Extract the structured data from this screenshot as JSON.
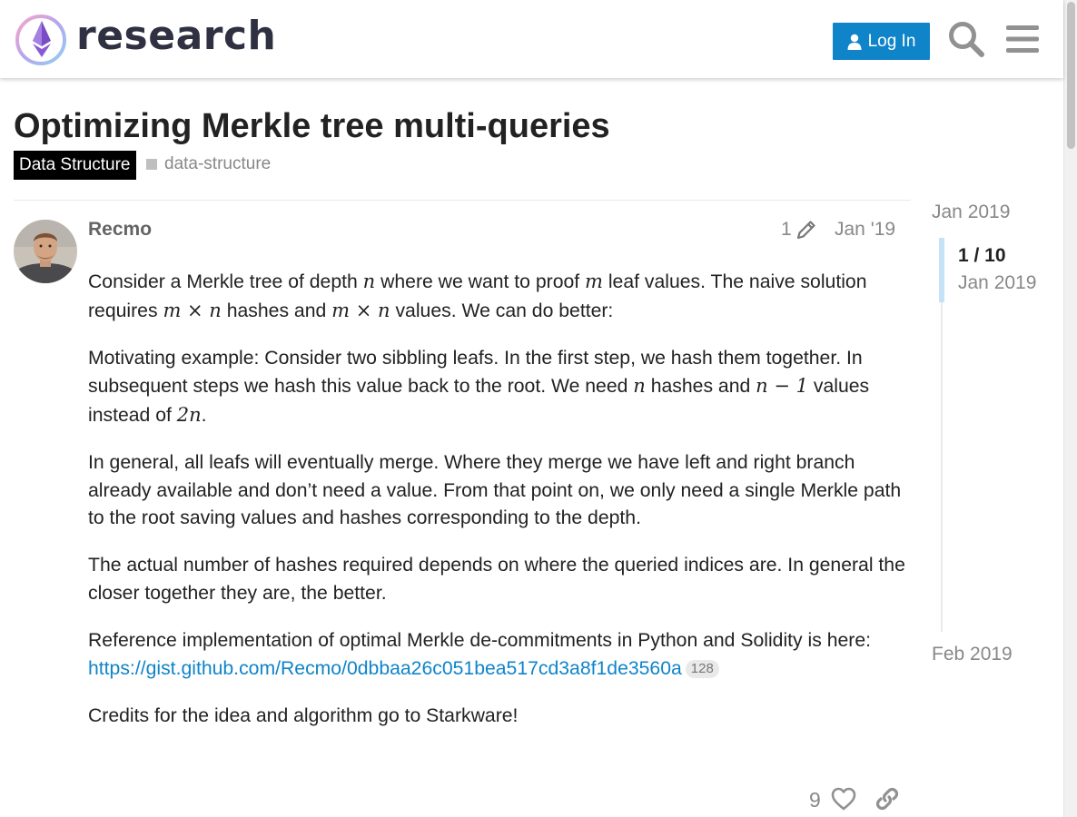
{
  "site": {
    "name": "research",
    "login_label": "Log In",
    "brand_color": "#0f84c9"
  },
  "topic": {
    "title": "Optimizing Merkle tree multi-queries",
    "category": "Data Structure",
    "tag": "data-structure"
  },
  "post": {
    "username": "Recmo",
    "edit_count": "1",
    "date": "Jan '19",
    "p1_a": "Consider a Merkle tree of depth ",
    "p1_math1": "n",
    "p1_b": " where we want to proof ",
    "p1_math2": "m",
    "p1_c": " leaf values. The naive solution requires ",
    "p1_math3": "m × n",
    "p1_d": " hashes and ",
    "p1_math4": "m × n",
    "p1_e": " values. We can do better:",
    "p2_a": "Motivating example: Consider two sibbling leafs. In the first step, we hash them together. In subsequent steps we hash this value back to the root. We need ",
    "p2_math1": "n",
    "p2_b": " hashes and ",
    "p2_math2": "n − 1",
    "p2_c": " values instead of ",
    "p2_math3": "2n",
    "p2_d": ".",
    "p3": "In general, all leafs will eventually merge. Where they merge we have left and right branch already available and don’t need a value. From that point on, we only need a single Merkle path to the root saving values and hashes corresponding to the depth.",
    "p4": "The actual number of hashes required depends on where the queried indices are. In general the closer together they are, the better.",
    "p5_text": "Reference implementation of optimal Merkle de-commitments in Python and Solidity is here: ",
    "p5_link": "https://gist.github.com/Recmo/0dbbaa26c051bea517cd3a8f1de3560a",
    "p5_clicks": "128",
    "p6": "Credits for the idea and algorithm go to Starkware!",
    "like_count": "9"
  },
  "timeline": {
    "start": "Jan 2019",
    "position": "1 / 10",
    "position_date": "Jan 2019",
    "end": "Feb 2019"
  }
}
